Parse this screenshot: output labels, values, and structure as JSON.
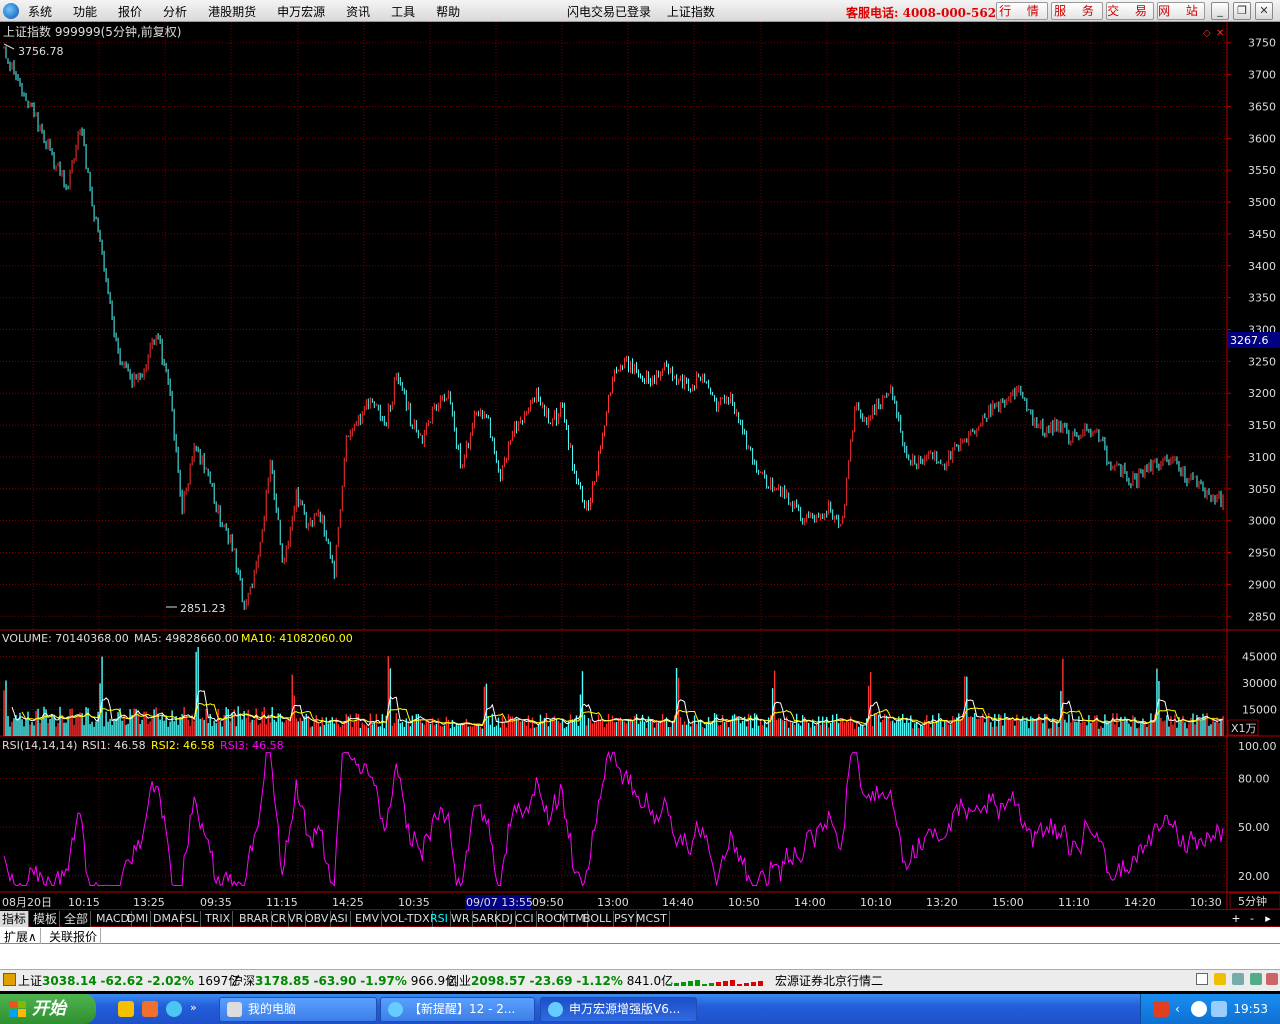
{
  "menu": {
    "items": [
      "系统",
      "功能",
      "报价",
      "分析",
      "港股期货",
      "申万宏源",
      "资讯",
      "工具",
      "帮助"
    ],
    "status_login": "闪电交易已登录",
    "status_index": "上证指数",
    "hotline": "客服电话: 4008-000-562",
    "buttons": [
      "行 情",
      "服 务",
      "交 易",
      "网 站"
    ]
  },
  "chart_header": {
    "title": "上证指数 999999(5分钟,前复权)",
    "high_label": "3756.78",
    "low_label": "2851.23",
    "current_price": "3267.6"
  },
  "volume_header": {
    "volume": "VOLUME: 70140368.00",
    "ma5": "MA5: 49828660.00",
    "ma10": "MA10: 41082060.00",
    "unit": "X1万"
  },
  "rsi_header": {
    "name": "RSI(14,14,14)",
    "rsi1": "RSI1: 46.58",
    "rsi2": "RSI2: 46.58",
    "rsi3": "RSI3: 46.58"
  },
  "time_axis": {
    "labels": [
      "08月20日",
      "10:15",
      "13:25",
      "09:35",
      "11:15",
      "14:25",
      "10:35",
      "09/07 13:55",
      "09:50",
      "13:00",
      "14:40",
      "10:50",
      "14:00",
      "10:10",
      "13:20",
      "15:00",
      "11:10",
      "14:20",
      "10:30"
    ],
    "period": "5分钟"
  },
  "tabs": {
    "first": "指标",
    "template": "模板",
    "all": "全部",
    "indicators": [
      "MACD",
      "DMI",
      "DMA",
      "FSL",
      "TRIX",
      "BRAR",
      "CR",
      "VR",
      "OBV",
      "ASI",
      "EMV",
      "VOL-TDX",
      "RSI",
      "WR",
      "SAR",
      "KDJ",
      "CCI",
      "ROC",
      "MTM",
      "BOLL",
      "PSY",
      "MCST"
    ],
    "active": "RSI",
    "plus": "+",
    "minus": "-",
    "arrow": "▸"
  },
  "ext": {
    "expand": "扩展∧",
    "related": "关联报价"
  },
  "status": {
    "sh_name": "上证",
    "sh_value": "3038.14",
    "sh_change": "-62.62",
    "sh_pct": "-2.02%",
    "sh_amount": "1697亿",
    "hs_name": "沪深",
    "hs_value": "3178.85",
    "hs_change": "-63.90",
    "hs_pct": "-1.97%",
    "hs_amount": "966.9亿",
    "cy_name": "创业",
    "cy_value": "2098.57",
    "cy_change": "-23.69",
    "cy_pct": "-1.12%",
    "cy_amount": "841.0亿",
    "broker": "宏源证券北京行情二"
  },
  "taskbar": {
    "start": "开始",
    "tasks": [
      "我的电脑",
      "【新提醒】12 - 2...",
      "申万宏源增强版V6..."
    ],
    "clock": "19:53"
  },
  "colors": {
    "grid": "#7a0000",
    "price_up": "#ff3232",
    "price_down": "#54ffff",
    "ma5": "#ffffff",
    "ma10": "#ffff00",
    "rsi": "#ff00ff",
    "current_price_bg": "#000080"
  },
  "chart_data": {
    "type": "candlestick",
    "price_ylim": [
      2830,
      3770
    ],
    "price_ticks": [
      3750,
      3700,
      3650,
      3600,
      3550,
      3500,
      3450,
      3400,
      3350,
      3300,
      3250,
      3200,
      3150,
      3100,
      3050,
      3000,
      2950,
      2900,
      2850
    ],
    "price_path_close": [
      3745,
      3690,
      3650,
      3610,
      3560,
      3520,
      3620,
      3495,
      3380,
      3260,
      3220,
      3230,
      3300,
      3210,
      3020,
      3110,
      3080,
      3000,
      2960,
      2860,
      2940,
      3090,
      2930,
      3040,
      2990,
      3010,
      2920,
      3140,
      3160,
      3190,
      3150,
      3230,
      3160,
      3130,
      3180,
      3200,
      3080,
      3160,
      3170,
      3060,
      3140,
      3170,
      3200,
      3150,
      3180,
      3060,
      3020,
      3120,
      3230,
      3250,
      3230,
      3220,
      3240,
      3220,
      3210,
      3230,
      3180,
      3200,
      3160,
      3090,
      3060,
      3050,
      3030,
      3000,
      3000,
      3020,
      2990,
      3180,
      3160,
      3190,
      3200,
      3100,
      3090,
      3110,
      3090,
      3110,
      3130,
      3160,
      3180,
      3190,
      3210,
      3160,
      3140,
      3150,
      3130,
      3140,
      3150,
      3090,
      3080,
      3060,
      3080,
      3090,
      3100,
      3070,
      3060,
      3040,
      3030
    ],
    "volume_ylim": [
      0,
      52000
    ],
    "volume_ticks": [
      45000,
      30000,
      15000
    ],
    "rsi_ylim": [
      10,
      105
    ],
    "rsi_ticks": [
      100.0,
      80.0,
      50.0,
      20.0
    ]
  }
}
